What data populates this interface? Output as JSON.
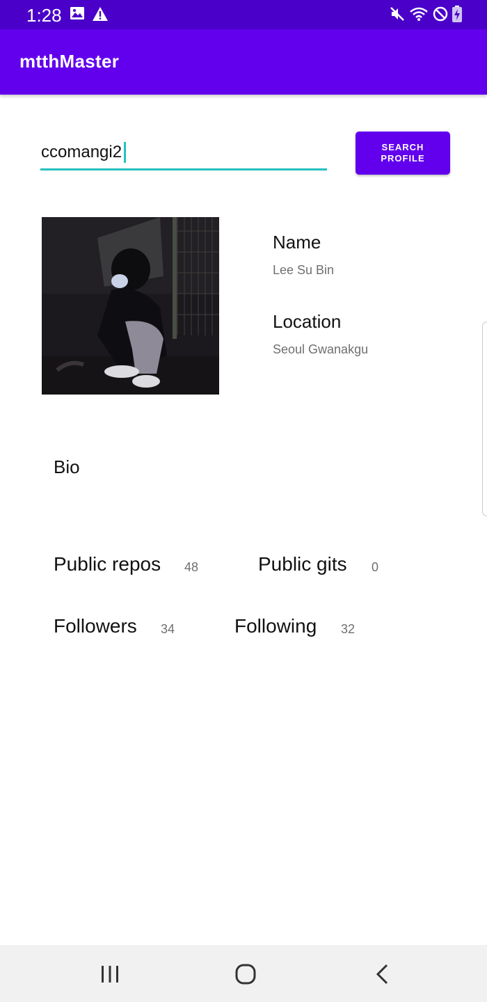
{
  "status_bar": {
    "time": "1:28",
    "left_icons": [
      "image-icon",
      "warning-icon"
    ],
    "right_icons": [
      "mute-icon",
      "wifi-icon",
      "do-not-disturb-icon",
      "battery-charging-icon"
    ]
  },
  "app_bar": {
    "title": "mtthMaster"
  },
  "search": {
    "value": "ccomangi2",
    "button_line1": "SEARCH",
    "button_line2": "PROFILE"
  },
  "profile": {
    "avatar_icon": "profile-photo",
    "name_label": "Name",
    "name_value": "Lee Su Bin",
    "location_label": "Location",
    "location_value": "Seoul Gwanakgu",
    "bio_label": "Bio"
  },
  "stats": {
    "public_repos_label": "Public repos",
    "public_repos_value": "48",
    "public_gits_label": "Public gits",
    "public_gits_value": "0",
    "followers_label": "Followers",
    "followers_value": "34",
    "following_label": "Following",
    "following_value": "32"
  },
  "nav_bar": {
    "icons": [
      "recent-apps-icon",
      "home-icon",
      "back-icon"
    ]
  },
  "colors": {
    "status_bar": "#4a00c9",
    "primary": "#6200ee",
    "accent": "#26bfbf"
  }
}
